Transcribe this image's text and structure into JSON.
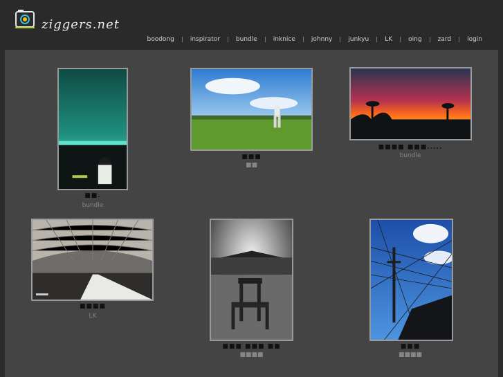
{
  "site": {
    "logo_text": "ziggers.net"
  },
  "nav": {
    "items": [
      "boodong",
      "inspirator",
      "bundle",
      "inknice",
      "johnny",
      "junkyu",
      "LK",
      "oing",
      "zard",
      "login"
    ]
  },
  "gallery": {
    "items": [
      {
        "title": "■■.",
        "author": "bundle"
      },
      {
        "title": "■■■",
        "author": "■■"
      },
      {
        "title": "■■■■ ■■■.....",
        "author": "bundle"
      },
      {
        "title": "■■■■",
        "author": "LK"
      },
      {
        "title": "■■■ ■■■ ■■",
        "author": "■■■■"
      },
      {
        "title": "■■■",
        "author": "■■■■"
      }
    ]
  }
}
